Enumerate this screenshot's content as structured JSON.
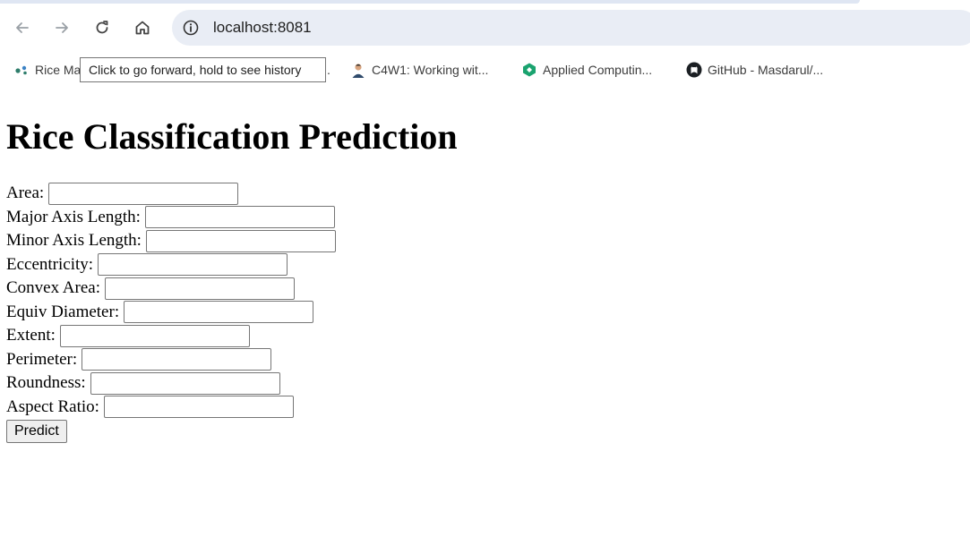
{
  "browser": {
    "url": "localhost:8081",
    "bookmarks": [
      {
        "label": "Rice Ma",
        "icon": "rice-favicon"
      },
      {
        "label": ".",
        "icon": ""
      },
      {
        "label": "C4W1: Working wit...",
        "icon": "avatar-favicon"
      },
      {
        "label": "Applied Computin...",
        "icon": "applied-favicon"
      },
      {
        "label": "GitHub - Masdarul/...",
        "icon": "github-icon"
      }
    ],
    "tooltip": "Click to go forward, hold to see history"
  },
  "page": {
    "title": "Rice Classification Prediction",
    "fields": [
      {
        "label": "Area:",
        "value": ""
      },
      {
        "label": "Major Axis Length:",
        "value": ""
      },
      {
        "label": "Minor Axis Length:",
        "value": ""
      },
      {
        "label": "Eccentricity:",
        "value": ""
      },
      {
        "label": "Convex Area:",
        "value": ""
      },
      {
        "label": "Equiv Diameter:",
        "value": ""
      },
      {
        "label": "Extent:",
        "value": ""
      },
      {
        "label": "Perimeter:",
        "value": ""
      },
      {
        "label": "Roundness:",
        "value": ""
      },
      {
        "label": "Aspect Ratio:",
        "value": ""
      }
    ],
    "submit_label": "Predict"
  }
}
